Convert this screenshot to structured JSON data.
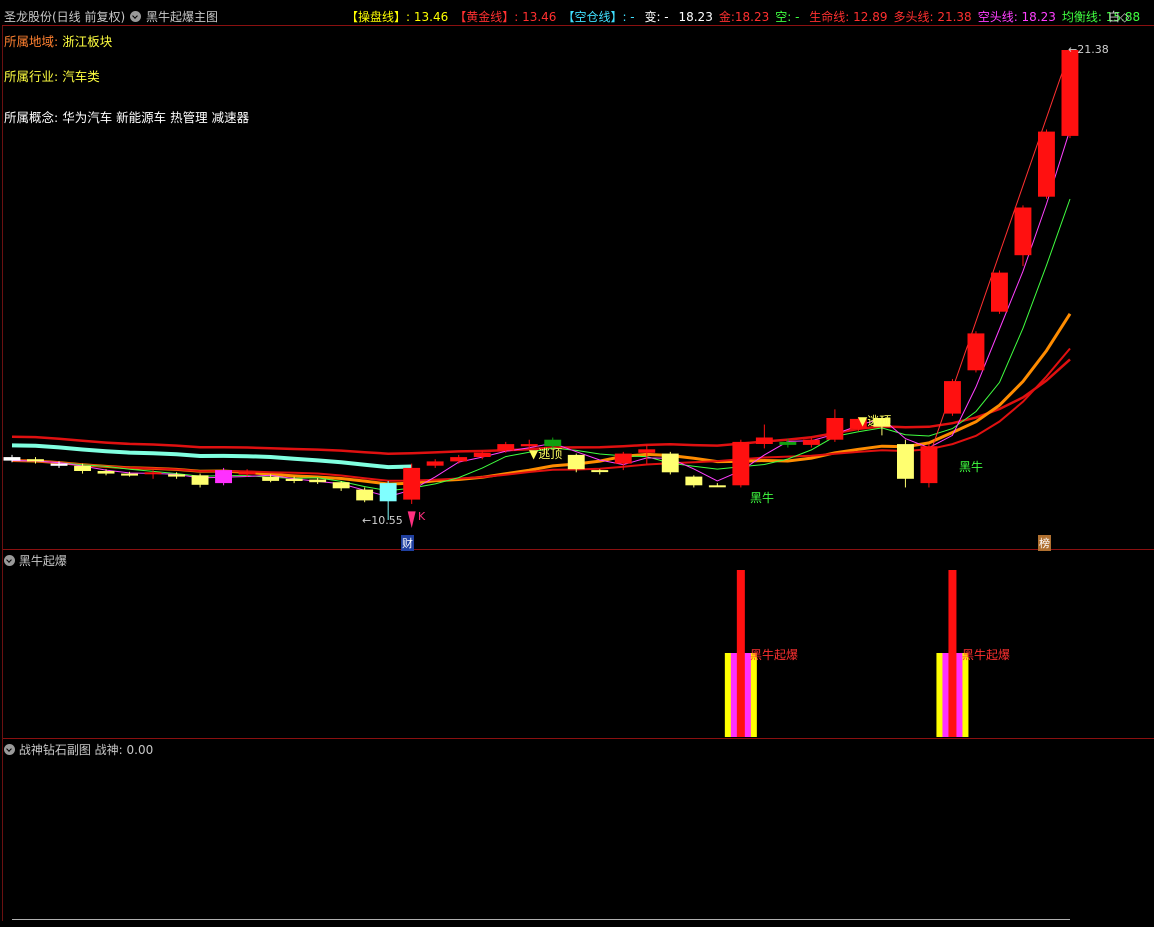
{
  "header": {
    "stock_title": "圣龙股份(日线 前复权)",
    "indicator_name": "黑牛起爆主图",
    "items": [
      {
        "label": "【操盘线】",
        "value": ": 13.46",
        "color": "#ffff00"
      },
      {
        "label": "【黄金线】",
        "value": ": 13.46",
        "color": "#ff3030"
      },
      {
        "label": "【空仓线】",
        "value": ": - ",
        "color": "#40e0ff"
      },
      {
        "label": "变:",
        "value": " - ",
        "color": "#ffffff"
      },
      {
        "label": "",
        "value": "18.23",
        "color": "#ffffff"
      },
      {
        "label": "金:",
        "value": "18.23",
        "color": "#ff3030"
      },
      {
        "label": "空:",
        "value": " - ",
        "color": "#40ff40"
      },
      {
        "label": "生命线:",
        "value": " 12.89",
        "color": "#ff3030"
      },
      {
        "label": "多头线:",
        "value": " 21.38",
        "color": "#ff3030"
      },
      {
        "label": "空头线:",
        "value": " 18.23",
        "color": "#ff40ff"
      },
      {
        "label": "均衡线:",
        "value": " 15.88",
        "color": "#40ff40"
      }
    ],
    "right_label": "白◇"
  },
  "info": {
    "region_label": "所属地域:",
    "region_value": "浙江板块",
    "industry_label": "所属行业:",
    "industry_value": "汽车类",
    "concept_label": "所属概念:",
    "concept_value": "华为汽车 新能源车 热管理 减速器"
  },
  "main_chart": {
    "high_label": "21.38",
    "low_label": "10.55",
    "signal_escape": "▼逃顶",
    "signal_black_bull": "黑牛",
    "marker_cai": "财",
    "marker_bang": "榜",
    "marker_k": "K"
  },
  "panel2": {
    "title": "黑牛起爆",
    "bar_label": "黑牛起爆"
  },
  "panel3": {
    "title": "战神钻石副图",
    "value_text": "战神: 0.00"
  },
  "chart_data": {
    "type": "candlestick",
    "x_index": [
      0,
      1,
      2,
      3,
      4,
      5,
      6,
      7,
      8,
      9,
      10,
      11,
      12,
      13,
      14,
      15,
      16,
      17,
      18,
      19,
      20,
      21,
      22,
      23,
      24,
      25,
      26,
      27,
      28,
      29,
      30,
      31,
      32,
      33,
      34,
      35,
      36,
      37,
      38,
      39,
      40,
      41,
      42,
      43,
      44,
      45
    ],
    "candles": [
      {
        "o": 12.0,
        "c": 11.92,
        "h": 12.05,
        "l": 11.88,
        "color": "white"
      },
      {
        "o": 11.95,
        "c": 11.9,
        "h": 12.0,
        "l": 11.85,
        "color": "yellow"
      },
      {
        "o": 11.85,
        "c": 11.8,
        "h": 11.9,
        "l": 11.75,
        "color": "white"
      },
      {
        "o": 11.8,
        "c": 11.68,
        "h": 11.85,
        "l": 11.62,
        "color": "yellow"
      },
      {
        "o": 11.68,
        "c": 11.62,
        "h": 11.72,
        "l": 11.58,
        "color": "yellow"
      },
      {
        "o": 11.62,
        "c": 11.6,
        "h": 11.66,
        "l": 11.55,
        "color": "yellow"
      },
      {
        "o": 11.62,
        "c": 11.65,
        "h": 11.7,
        "l": 11.5,
        "color": "red"
      },
      {
        "o": 11.6,
        "c": 11.55,
        "h": 11.65,
        "l": 11.5,
        "color": "yellow"
      },
      {
        "o": 11.58,
        "c": 11.36,
        "h": 11.62,
        "l": 11.3,
        "color": "yellow"
      },
      {
        "o": 11.4,
        "c": 11.7,
        "h": 11.75,
        "l": 11.35,
        "color": "magenta"
      },
      {
        "o": 11.65,
        "c": 11.6,
        "h": 11.72,
        "l": 11.55,
        "color": "red"
      },
      {
        "o": 11.55,
        "c": 11.45,
        "h": 11.6,
        "l": 11.42,
        "color": "yellow"
      },
      {
        "o": 11.5,
        "c": 11.45,
        "h": 11.55,
        "l": 11.4,
        "color": "yellow"
      },
      {
        "o": 11.48,
        "c": 11.42,
        "h": 11.52,
        "l": 11.38,
        "color": "yellow"
      },
      {
        "o": 11.42,
        "c": 11.28,
        "h": 11.45,
        "l": 11.22,
        "color": "yellow"
      },
      {
        "o": 11.25,
        "c": 11.0,
        "h": 11.3,
        "l": 10.96,
        "color": "yellow"
      },
      {
        "o": 11.4,
        "c": 10.98,
        "h": 11.45,
        "l": 10.55,
        "color": "cyan"
      },
      {
        "o": 11.02,
        "c": 11.75,
        "h": 11.85,
        "l": 10.92,
        "color": "red"
      },
      {
        "o": 11.8,
        "c": 11.9,
        "h": 11.95,
        "l": 11.75,
        "color": "red"
      },
      {
        "o": 11.9,
        "c": 12.0,
        "h": 12.05,
        "l": 11.85,
        "color": "red"
      },
      {
        "o": 12.0,
        "c": 12.1,
        "h": 12.15,
        "l": 11.95,
        "color": "red"
      },
      {
        "o": 12.15,
        "c": 12.3,
        "h": 12.35,
        "l": 12.1,
        "color": "red"
      },
      {
        "o": 12.3,
        "c": 12.25,
        "h": 12.4,
        "l": 12.2,
        "color": "red"
      },
      {
        "o": 12.25,
        "c": 12.4,
        "h": 12.45,
        "l": 12.2,
        "color": "green"
      },
      {
        "o": 12.05,
        "c": 11.72,
        "h": 12.08,
        "l": 11.65,
        "color": "yellow"
      },
      {
        "o": 11.7,
        "c": 11.68,
        "h": 11.72,
        "l": 11.6,
        "color": "yellow"
      },
      {
        "o": 11.85,
        "c": 12.08,
        "h": 12.12,
        "l": 11.7,
        "color": "red"
      },
      {
        "o": 12.1,
        "c": 12.18,
        "h": 12.28,
        "l": 11.85,
        "color": "red"
      },
      {
        "o": 12.08,
        "c": 11.65,
        "h": 12.12,
        "l": 11.6,
        "color": "yellow"
      },
      {
        "o": 11.55,
        "c": 11.35,
        "h": 11.58,
        "l": 11.3,
        "color": "yellow"
      },
      {
        "o": 11.35,
        "c": 11.35,
        "h": 11.4,
        "l": 11.32,
        "color": "yellow"
      },
      {
        "o": 11.35,
        "c": 12.35,
        "h": 12.4,
        "l": 11.3,
        "color": "red"
      },
      {
        "o": 12.3,
        "c": 12.45,
        "h": 12.75,
        "l": 12.2,
        "color": "red"
      },
      {
        "o": 12.35,
        "c": 12.28,
        "h": 12.42,
        "l": 12.22,
        "color": "green"
      },
      {
        "o": 12.28,
        "c": 12.4,
        "h": 12.45,
        "l": 12.22,
        "color": "red"
      },
      {
        "o": 12.4,
        "c": 12.9,
        "h": 13.1,
        "l": 12.35,
        "color": "red"
      },
      {
        "o": 12.65,
        "c": 12.88,
        "h": 12.92,
        "l": 12.6,
        "color": "red"
      },
      {
        "o": 12.7,
        "c": 12.9,
        "h": 12.95,
        "l": 12.5,
        "color": "yellow"
      },
      {
        "o": 12.3,
        "c": 11.5,
        "h": 12.4,
        "l": 11.3,
        "color": "yellow"
      },
      {
        "o": 11.4,
        "c": 12.25,
        "h": 12.3,
        "l": 11.3,
        "color": "red"
      },
      {
        "o": 13.0,
        "c": 13.75,
        "h": 13.8,
        "l": 12.95,
        "color": "red"
      },
      {
        "o": 14.0,
        "c": 14.85,
        "h": 14.9,
        "l": 13.95,
        "color": "red"
      },
      {
        "o": 15.35,
        "c": 16.25,
        "h": 16.3,
        "l": 15.3,
        "color": "red"
      },
      {
        "o": 16.65,
        "c": 17.75,
        "h": 17.8,
        "l": 16.4,
        "color": "red"
      },
      {
        "o": 18.0,
        "c": 19.5,
        "h": 19.55,
        "l": 17.95,
        "color": "red"
      },
      {
        "o": 19.4,
        "c": 21.38,
        "h": 21.38,
        "l": 19.35,
        "color": "red"
      }
    ],
    "sub_signal_bars": [
      31,
      40
    ],
    "legend_values": {
      "操盘线": 13.46,
      "黄金线": 13.46,
      "变": 18.23,
      "金": 18.23,
      "生命线": 12.89,
      "多头线": 21.38,
      "空头线": 18.23,
      "均衡线": 15.88
    },
    "price_range": [
      10.55,
      21.38
    ],
    "colors": {
      "up": "#ff0000",
      "down": "#ffff40",
      "red_line": "#e01010",
      "orange_line": "#ff8c00",
      "magenta_line": "#ff40ff",
      "green_line": "#40ff40",
      "cyan_band": "#80ffe0"
    }
  }
}
